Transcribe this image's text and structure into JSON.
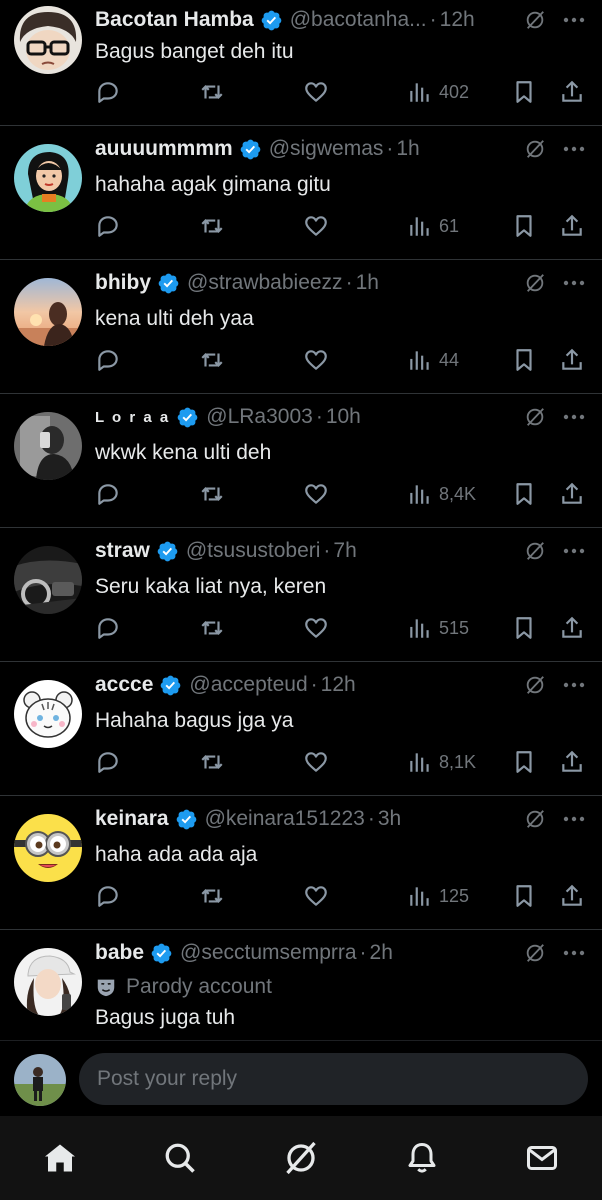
{
  "colors": {
    "background": "#000000",
    "text_primary": "#e7e9ea",
    "text_secondary": "#71767b",
    "verified_blue": "#1d9bf0",
    "divider": "#2f3336",
    "nav_background": "#121212",
    "input_background": "#202327"
  },
  "replies": [
    {
      "name": "Bacotan Hamba",
      "verified": true,
      "handle": "@bacotanha...",
      "time": "12h",
      "parody_label": null,
      "text": "Bagus banget deh itu",
      "views": "402",
      "avatar_icon": "gamer-glasses-avatar"
    },
    {
      "name": "auuuummmm",
      "verified": true,
      "handle": "@sigwemas",
      "time": "1h",
      "parody_label": null,
      "text": "hahaha agak gimana gitu",
      "views": "61",
      "avatar_icon": "animated-princess-avatar"
    },
    {
      "name": "bhiby",
      "verified": true,
      "handle": "@strawbabieezz",
      "time": "1h",
      "parody_label": null,
      "text": "kena ulti deh yaa",
      "views": "44",
      "avatar_icon": "sunset-silhouette-avatar"
    },
    {
      "name": "L o r a a",
      "verified": true,
      "handle": "@LRa3003",
      "time": "10h",
      "parody_label": null,
      "text": "wkwk kena ulti deh",
      "views": "8,4K",
      "avatar_icon": "mirror-selfie-avatar"
    },
    {
      "name": "straw",
      "verified": true,
      "handle": "@tsusustoberi",
      "time": "7h",
      "parody_label": null,
      "text": "Seru kaka liat nya, keren",
      "views": "515",
      "avatar_icon": "car-interior-avatar"
    },
    {
      "name": "accce",
      "verified": true,
      "handle": "@accepteud",
      "time": "12h",
      "parody_label": null,
      "text": "Hahaha bagus jga ya",
      "views": "8,1K",
      "avatar_icon": "cartoon-tiger-avatar"
    },
    {
      "name": "keinara",
      "verified": true,
      "handle": "@keinara151223",
      "time": "3h",
      "parody_label": null,
      "text": "haha ada ada aja",
      "views": "125",
      "avatar_icon": "minion-avatar"
    },
    {
      "name": "babe",
      "verified": true,
      "handle": "@secctumsemprra",
      "time": "2h",
      "parody_label": "Parody account",
      "text": "Bagus juga tuh",
      "views": null,
      "avatar_icon": "cap-girl-avatar"
    }
  ],
  "reply_bar": {
    "placeholder": "Post your reply",
    "avatar_icon": "user-avatar"
  },
  "bottom_nav": [
    {
      "icon": "home-icon",
      "active": true
    },
    {
      "icon": "search-icon",
      "active": false
    },
    {
      "icon": "grok-icon",
      "active": false
    },
    {
      "icon": "notifications-icon",
      "active": false
    },
    {
      "icon": "messages-icon",
      "active": false
    }
  ]
}
